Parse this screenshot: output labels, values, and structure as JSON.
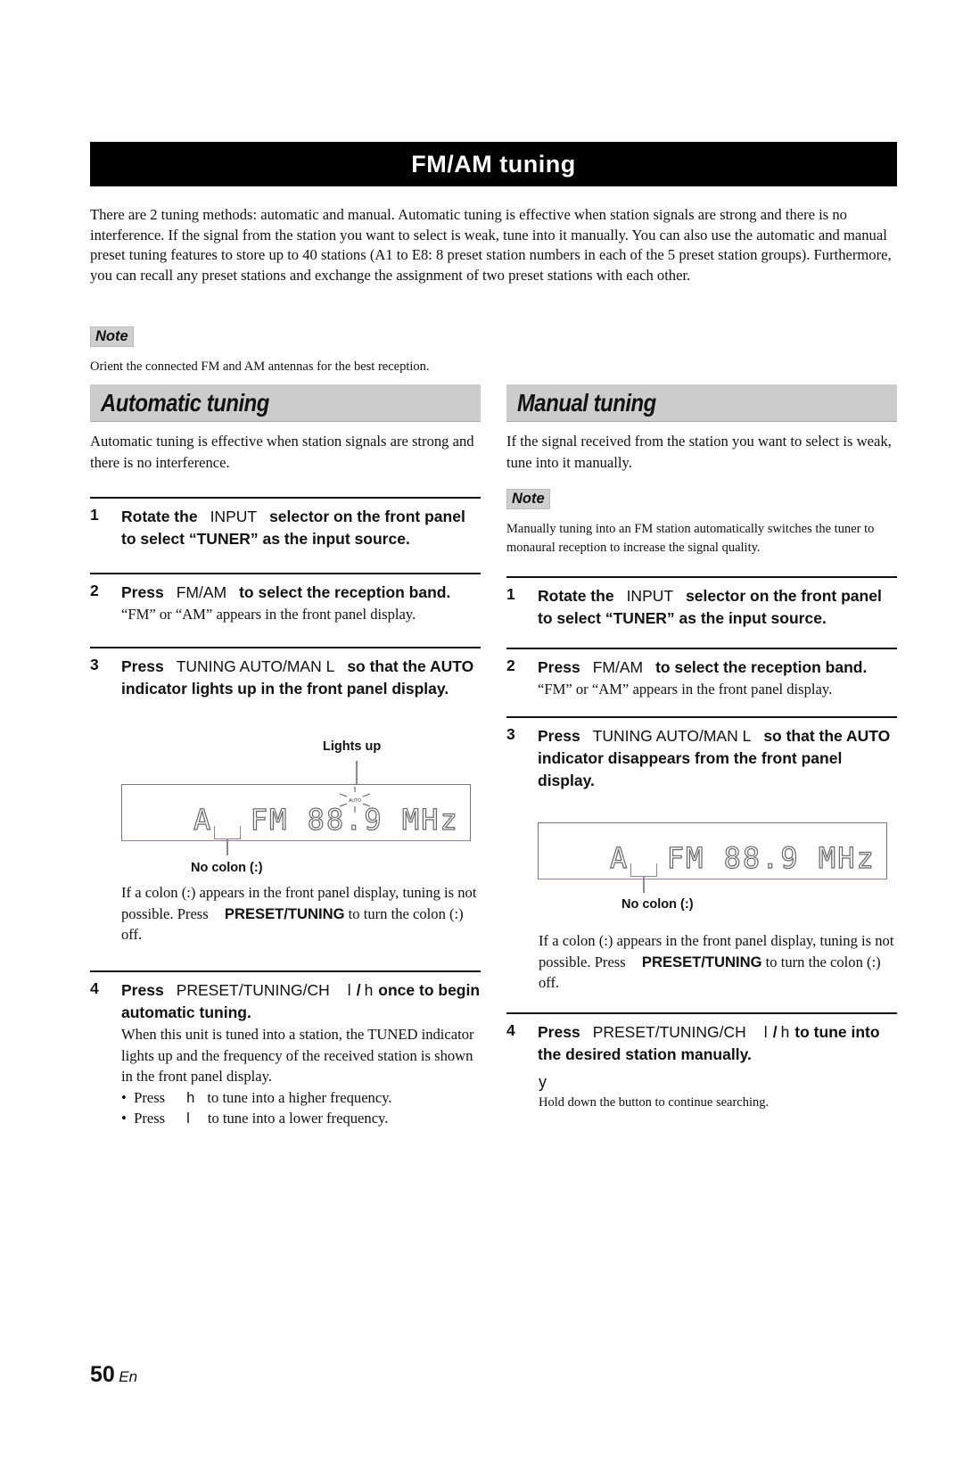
{
  "title": "FM/AM tuning",
  "intro": "There are 2 tuning methods: automatic and manual. Automatic tuning is effective when station signals are strong and there is no interference. If the signal from the station you want to select is weak, tune into it manually. You can also use the automatic and manual preset tuning features to store up to 40 stations (A1 to E8: 8 preset station numbers in each of the 5 preset station groups). Furthermore, you can recall any preset stations and exchange the assignment of two preset stations with each other.",
  "top_note": {
    "tag": "Note",
    "text": "Orient the connected FM and AM antennas for the best reception."
  },
  "automatic": {
    "heading": "Automatic tuning",
    "intro": "Automatic tuning is effective when station signals are strong and there is no interference.",
    "steps": [
      {
        "num": "1",
        "pre": "Rotate the",
        "key": "INPUT",
        "post": "selector on the front panel to select “TUNER” as the input source."
      },
      {
        "num": "2",
        "pre": "Press",
        "key": "FM/AM",
        "post": "to select the reception band.",
        "sub": "“FM” or “AM” appears in the front panel display."
      },
      {
        "num": "3",
        "pre": "Press",
        "key": "TUNING AUTO/MAN L",
        "post": "so that the AUTO indicator lights up in the front panel display."
      },
      {
        "num": "4",
        "pre": "Press",
        "key": "PRESET/TUNING/CH",
        "key2": "l",
        "slash": "/",
        "key3": "h",
        "post": "once to begin automatic tuning.",
        "sub": "When this unit is tuned into a station, the TUNED indicator lights up and the frequency of the received station is shown in the front panel display."
      }
    ],
    "display": {
      "callout_top": "Lights up",
      "indicator": "AUTO",
      "text": "A  FM 88.9 MHz",
      "callout_bottom": "No colon (:)"
    },
    "colon_note_pre": "If a colon (:) appears in the front panel display, tuning is not possible. Press",
    "colon_note_key": "PRESET/TUNING",
    "colon_note_post": "to turn the colon (:) off.",
    "bullets": [
      {
        "pre": "Press",
        "key": "h",
        "post": "to tune into a higher frequency."
      },
      {
        "pre": "Press",
        "key": "l",
        "post": "to tune into a lower frequency."
      }
    ]
  },
  "manual": {
    "heading": "Manual tuning",
    "intro": "If the signal received from the station you want to select is weak, tune into it manually.",
    "note": {
      "tag": "Note",
      "text": "Manually tuning into an FM station automatically switches the tuner to monaural reception to increase the signal quality."
    },
    "steps": [
      {
        "num": "1",
        "pre": "Rotate the",
        "key": "INPUT",
        "post": "selector on the front panel to select “TUNER” as the input source."
      },
      {
        "num": "2",
        "pre": "Press",
        "key": "FM/AM",
        "post": "to select the reception band.",
        "sub": "“FM” or “AM” appears in the front panel display."
      },
      {
        "num": "3",
        "pre": "Press",
        "key": "TUNING AUTO/MAN L",
        "post": "so that the AUTO indicator disappears from the front panel display."
      },
      {
        "num": "4",
        "pre": "Press",
        "key": "PRESET/TUNING/CH",
        "key2": "l",
        "slash": "/",
        "key3": "h",
        "post": "to tune into the desired station manually."
      }
    ],
    "display": {
      "text": "A  FM 88.9 MHz",
      "callout_bottom": "No colon (:)"
    },
    "colon_note_pre": "If a colon (:) appears in the front panel display, tuning is not possible. Press",
    "colon_note_key": "PRESET/TUNING",
    "colon_note_post": "to turn the colon (:) off.",
    "tip_glyph": "y",
    "tip_text": "Hold down the button to continue searching."
  },
  "footer": {
    "page_number": "50",
    "lang": "En"
  }
}
